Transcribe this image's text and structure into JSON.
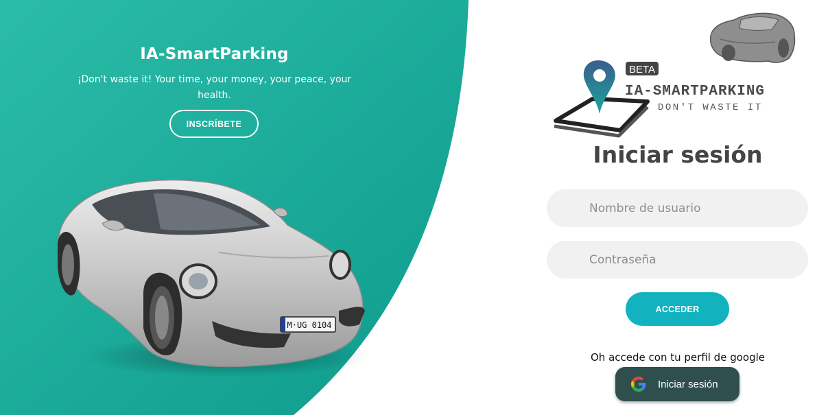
{
  "hero": {
    "title": "IA-SmartParking",
    "subtitle": "¡Don't waste it! Your time, your money, your peace, your health.",
    "signup_label": "INSCRÍBETE",
    "plate_text": "M·UG 0104"
  },
  "logo": {
    "badge": "BETA",
    "name": "IA-SMARTPARKING",
    "tagline": "DON'T WASTE IT"
  },
  "login": {
    "title": "Iniciar sesión",
    "username_placeholder": "Nombre de usuario",
    "password_placeholder": "Contraseña",
    "submit_label": "ACCEDER",
    "google_text": "Oh accede con tu perfil de google",
    "google_button_label": "Iniciar sesión"
  },
  "colors": {
    "teal_light": "#26b8a6",
    "teal_dark": "#0e9a8c",
    "accent_button": "#12b3bf",
    "google_button_bg": "#2f4f4f",
    "title_text": "#444444"
  },
  "icons": [
    "car-silhouette-icon",
    "location-pin-icon",
    "google-icon"
  ]
}
